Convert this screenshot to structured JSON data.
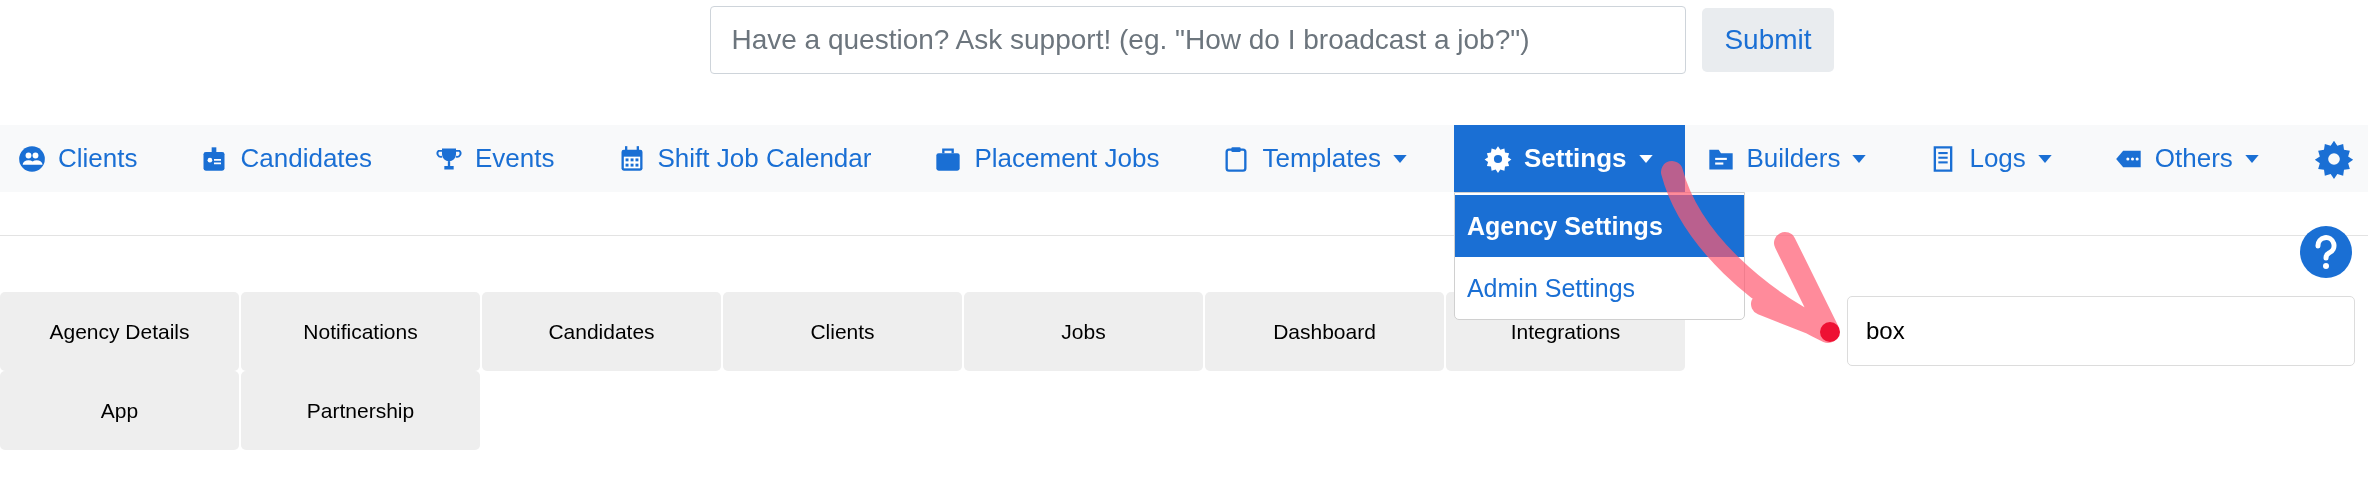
{
  "support": {
    "placeholder": "Have a question? Ask support! (eg. \"How do I broadcast a job?\")",
    "button": "Submit"
  },
  "nav": [
    {
      "label": "Clients",
      "selected": false,
      "caret": false
    },
    {
      "label": "Candidates",
      "selected": false,
      "caret": false
    },
    {
      "label": "Events",
      "selected": false,
      "caret": false
    },
    {
      "label": "Shift Job Calendar",
      "selected": false,
      "caret": false
    },
    {
      "label": "Placement Jobs",
      "selected": false,
      "caret": false
    },
    {
      "label": "Templates",
      "selected": false,
      "caret": true
    },
    {
      "label": "Settings",
      "selected": true,
      "caret": true
    },
    {
      "label": "Builders",
      "selected": false,
      "caret": true
    },
    {
      "label": "Logs",
      "selected": false,
      "caret": true
    },
    {
      "label": "Others",
      "selected": false,
      "caret": true
    }
  ],
  "settings_menu": [
    {
      "label": "Agency Settings",
      "selected": true
    },
    {
      "label": "Admin Settings",
      "selected": false
    }
  ],
  "tabs": [
    "Agency Details",
    "Notifications",
    "Candidates",
    "Clients",
    "Jobs",
    "Dashboard",
    "Integrations",
    "App",
    "Partnership"
  ],
  "filter": {
    "value": "box"
  }
}
